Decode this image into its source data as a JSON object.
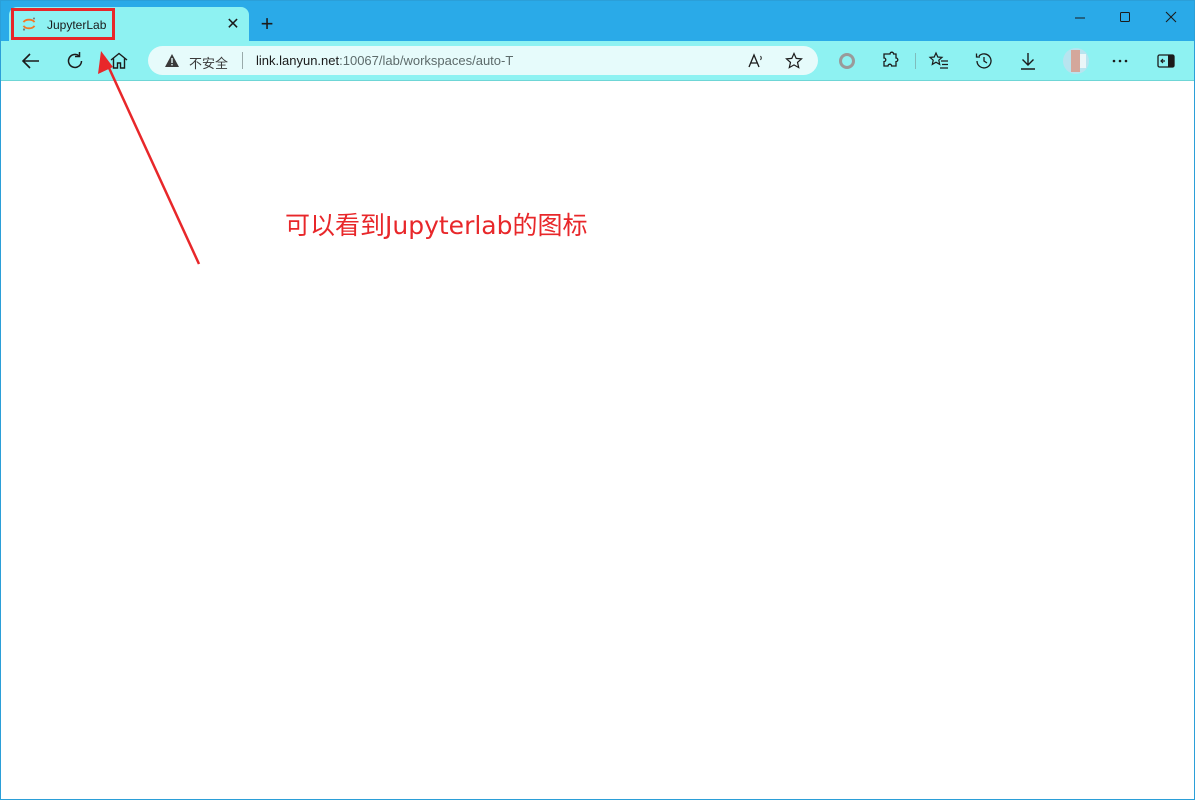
{
  "browser": {
    "tab": {
      "title": "JupyterLab",
      "icon": "jupyter-logo-icon",
      "close_icon": "close-icon"
    },
    "new_tab_icon": "plus-icon",
    "window_controls": [
      "minimize-icon",
      "maximize-icon",
      "close-icon"
    ],
    "address_bar": {
      "security_icon": "warning-triangle-icon",
      "security_label": "不安全",
      "url_host": "link.lanyun.net",
      "url_rest": ":10067/lab/workspaces/auto-T",
      "read_aloud_icon": "read-aloud-icon",
      "favorite_icon": "star-icon"
    },
    "toolbar_icons": [
      "back-icon",
      "refresh-icon",
      "home-icon",
      "browser-essentials-icon",
      "extensions-icon",
      "favorites-icon",
      "history-icon",
      "downloads-icon",
      "profile-avatar",
      "more-icon",
      "sidebar-icon"
    ]
  },
  "annotation": {
    "text": "可以看到Jupyterlab的图标",
    "color": "#e8272a"
  },
  "colors": {
    "title_bar": "#2aaae8",
    "tab_and_toolbar": "#8ef2f2",
    "highlight": "#e8272a",
    "jupyter_orange": "#f37726"
  }
}
